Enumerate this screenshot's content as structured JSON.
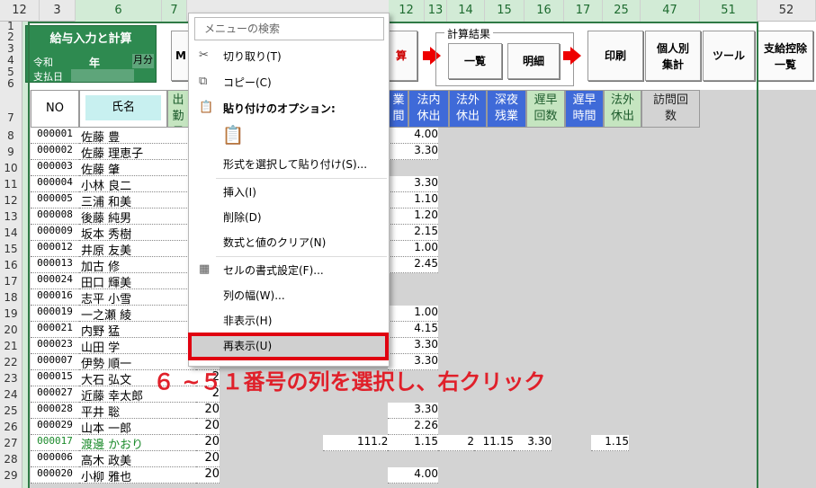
{
  "column_headers": [
    "12",
    "3",
    "6",
    "7",
    "8",
    "9",
    "10",
    "11",
    "12",
    "13",
    "14",
    "15",
    "16",
    "17",
    "25",
    "47",
    "51",
    "52"
  ],
  "row_headers": [
    "1",
    "2",
    "3",
    "4",
    "5",
    "6",
    "7",
    "8",
    "9",
    "10",
    "11",
    "12",
    "13",
    "14",
    "15",
    "16",
    "17",
    "18",
    "19",
    "20",
    "21",
    "22",
    "23",
    "24",
    "25",
    "26",
    "27",
    "28",
    "29"
  ],
  "title_box": {
    "title": "給与入力と計算",
    "era": "令和",
    "year": "年",
    "month": "月分",
    "payday": "支払日"
  },
  "buttons": {
    "m": "M",
    "calc": "算",
    "summary": "一覧",
    "detail": "明細",
    "print": "印刷",
    "per_person": "個人別\n集計",
    "tools": "ツール",
    "deduction": "支給控除\n一覧",
    "calc_result_group": "計算結果"
  },
  "table_headers": {
    "no": "NO",
    "name": "氏名",
    "days": "出勤\n日数",
    "col11": "業\n間",
    "legal_holiday": "法内\n休出",
    "outside_holiday": "法外\n休出",
    "night_overtime": "深夜\n残業",
    "late_count": "遅早\n回数",
    "late_time": "遅早\n時間",
    "outside_holiday2": "法外\n休出",
    "visits": "訪問回\n数"
  },
  "rows": [
    {
      "no": "000001",
      "name": "佐藤 豊",
      "days": "2",
      "v11": "4.00"
    },
    {
      "no": "000002",
      "name": "佐藤 理恵子",
      "days": "2",
      "v11": "3.30"
    },
    {
      "no": "000003",
      "name": "佐藤 肇",
      "days": "2",
      "v11": ""
    },
    {
      "no": "000004",
      "name": "小林 良二",
      "days": "2",
      "v11": "3.30"
    },
    {
      "no": "000005",
      "name": "三浦 和美",
      "days": "2",
      "v11": "1.10"
    },
    {
      "no": "000008",
      "name": "後藤 純男",
      "days": "2",
      "v11": "1.20"
    },
    {
      "no": "000009",
      "name": "坂本 秀樹",
      "days": "2",
      "v11": "2.15"
    },
    {
      "no": "000012",
      "name": "井原 友美",
      "days": "2",
      "v11": "1.00"
    },
    {
      "no": "000013",
      "name": "加古 修",
      "days": "2",
      "v11": "2.45"
    },
    {
      "no": "000024",
      "name": "田口 輝美",
      "days": "2",
      "v11": ""
    },
    {
      "no": "000016",
      "name": "志平 小雪",
      "days": "2",
      "v11": ""
    },
    {
      "no": "000019",
      "name": "一之瀬 綾",
      "days": "2",
      "v11": "1.00"
    },
    {
      "no": "000021",
      "name": "内野 猛",
      "days": "2",
      "v11": "4.15"
    },
    {
      "no": "000023",
      "name": "山田 学",
      "days": "2",
      "v11": "3.30"
    },
    {
      "no": "000007",
      "name": "伊勢 順一",
      "days": "2",
      "v11": "3.30"
    },
    {
      "no": "000015",
      "name": "大石 弘文",
      "days": "2",
      "v11": ""
    },
    {
      "no": "000027",
      "name": "近藤 幸太郎",
      "days": "2",
      "v11": ""
    },
    {
      "no": "000028",
      "name": "平井 聡",
      "days": "20",
      "v11": "3.30"
    },
    {
      "no": "000029",
      "name": "山本 一郎",
      "days": "20",
      "v11": "2.26"
    },
    {
      "no": "000017",
      "name": "渡邊 かおり",
      "days": "20",
      "v10": "111.28",
      "v11": "1.15",
      "v12": "2",
      "v13": "11.15",
      "v14": "3.30",
      "v16": "1.15"
    },
    {
      "no": "000006",
      "name": "高木 政美",
      "days": "20",
      "v11": ""
    },
    {
      "no": "000020",
      "name": "小柳 雅也",
      "days": "20",
      "v11": "4.00"
    }
  ],
  "context_menu": {
    "search_placeholder": "メニューの検索",
    "cut": "切り取り(T)",
    "copy": "コピー(C)",
    "paste_options": "貼り付けのオプション:",
    "paste_special": "形式を選択して貼り付け(S)...",
    "insert": "挿入(I)",
    "delete": "削除(D)",
    "clear": "数式と値のクリア(N)",
    "format_cells": "セルの書式設定(F)...",
    "column_width": "列の幅(W)...",
    "hide": "非表示(H)",
    "unhide": "再表示(U)"
  },
  "caption": "６ ~５１番号の列を選択し、右クリック",
  "colors": {
    "accent_green": "#2e8a50",
    "header_blue": "#3f6ad8",
    "highlight_red": "#e00010"
  }
}
